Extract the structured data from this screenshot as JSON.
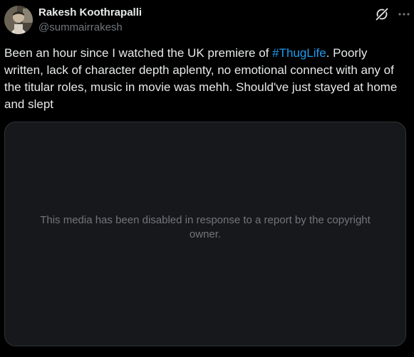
{
  "author": {
    "display_name": "Rakesh Koothrapalli",
    "handle": "@summairrakesh"
  },
  "header_actions": {
    "grok_icon": "grok-icon",
    "more_icon": "more-icon"
  },
  "tweet": {
    "text_before": "Been an hour since I watched the UK premiere of ",
    "hashtag": "#ThugLife",
    "text_after": ". Poorly written, lack of character depth aplenty, no emotional connect with any of the titular roles, music in movie was mehh. Should've just stayed at home and slept"
  },
  "media": {
    "message": "This media has been disabled in response to a report by the copyright owner."
  },
  "colors": {
    "background": "#000000",
    "text_primary": "#e7e9ea",
    "text_secondary": "#71767b",
    "hashtag": "#1d9bf0",
    "media_bg": "#16181c",
    "border": "#2f3336"
  }
}
